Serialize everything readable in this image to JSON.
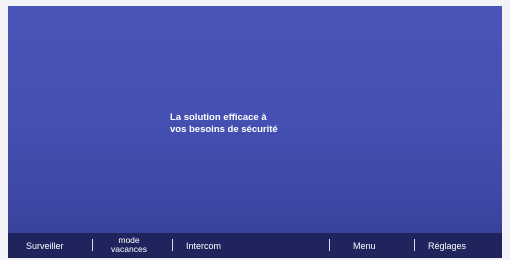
{
  "splash": {
    "line1": "La solution efficace à",
    "line2": "vos besoins de sécurité"
  },
  "bottom_bar": {
    "surveiller": "Surveiller",
    "mode_vacances_line1": "mode",
    "mode_vacances_line2": "vacances",
    "intercom": "Intercom",
    "menu": "Menu",
    "reglages": "Réglages"
  },
  "colors": {
    "screen_top": "#4b54b8",
    "screen_bottom": "#343d90",
    "bar": "#1f255c",
    "text": "#ffffff"
  }
}
